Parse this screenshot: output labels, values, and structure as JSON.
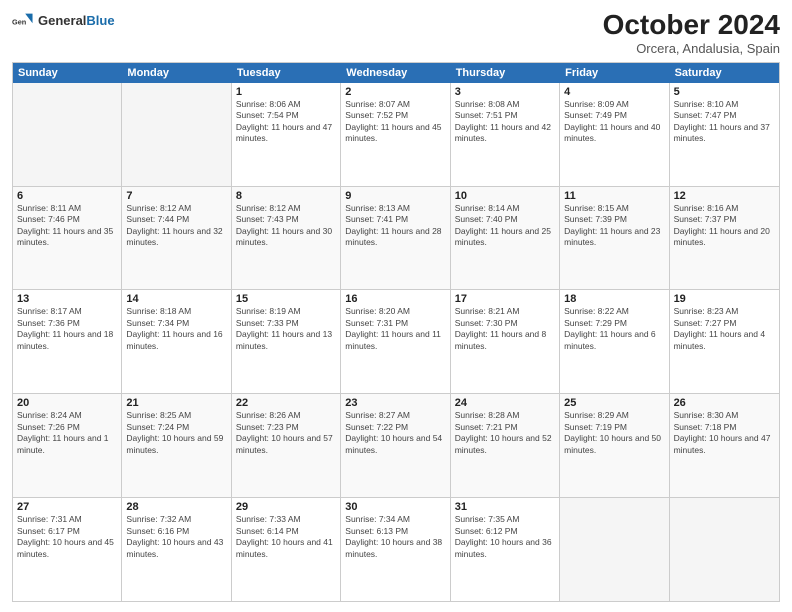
{
  "header": {
    "logo": {
      "text_general": "General",
      "text_blue": "Blue"
    },
    "title": "October 2024",
    "location": "Orcera, Andalusia, Spain"
  },
  "calendar": {
    "weekdays": [
      "Sunday",
      "Monday",
      "Tuesday",
      "Wednesday",
      "Thursday",
      "Friday",
      "Saturday"
    ],
    "rows": [
      [
        {
          "day": "",
          "empty": true
        },
        {
          "day": "",
          "empty": true
        },
        {
          "day": "1",
          "sunrise": "Sunrise: 8:06 AM",
          "sunset": "Sunset: 7:54 PM",
          "daylight": "Daylight: 11 hours and 47 minutes."
        },
        {
          "day": "2",
          "sunrise": "Sunrise: 8:07 AM",
          "sunset": "Sunset: 7:52 PM",
          "daylight": "Daylight: 11 hours and 45 minutes."
        },
        {
          "day": "3",
          "sunrise": "Sunrise: 8:08 AM",
          "sunset": "Sunset: 7:51 PM",
          "daylight": "Daylight: 11 hours and 42 minutes."
        },
        {
          "day": "4",
          "sunrise": "Sunrise: 8:09 AM",
          "sunset": "Sunset: 7:49 PM",
          "daylight": "Daylight: 11 hours and 40 minutes."
        },
        {
          "day": "5",
          "sunrise": "Sunrise: 8:10 AM",
          "sunset": "Sunset: 7:47 PM",
          "daylight": "Daylight: 11 hours and 37 minutes."
        }
      ],
      [
        {
          "day": "6",
          "sunrise": "Sunrise: 8:11 AM",
          "sunset": "Sunset: 7:46 PM",
          "daylight": "Daylight: 11 hours and 35 minutes."
        },
        {
          "day": "7",
          "sunrise": "Sunrise: 8:12 AM",
          "sunset": "Sunset: 7:44 PM",
          "daylight": "Daylight: 11 hours and 32 minutes."
        },
        {
          "day": "8",
          "sunrise": "Sunrise: 8:12 AM",
          "sunset": "Sunset: 7:43 PM",
          "daylight": "Daylight: 11 hours and 30 minutes."
        },
        {
          "day": "9",
          "sunrise": "Sunrise: 8:13 AM",
          "sunset": "Sunset: 7:41 PM",
          "daylight": "Daylight: 11 hours and 28 minutes."
        },
        {
          "day": "10",
          "sunrise": "Sunrise: 8:14 AM",
          "sunset": "Sunset: 7:40 PM",
          "daylight": "Daylight: 11 hours and 25 minutes."
        },
        {
          "day": "11",
          "sunrise": "Sunrise: 8:15 AM",
          "sunset": "Sunset: 7:39 PM",
          "daylight": "Daylight: 11 hours and 23 minutes."
        },
        {
          "day": "12",
          "sunrise": "Sunrise: 8:16 AM",
          "sunset": "Sunset: 7:37 PM",
          "daylight": "Daylight: 11 hours and 20 minutes."
        }
      ],
      [
        {
          "day": "13",
          "sunrise": "Sunrise: 8:17 AM",
          "sunset": "Sunset: 7:36 PM",
          "daylight": "Daylight: 11 hours and 18 minutes."
        },
        {
          "day": "14",
          "sunrise": "Sunrise: 8:18 AM",
          "sunset": "Sunset: 7:34 PM",
          "daylight": "Daylight: 11 hours and 16 minutes."
        },
        {
          "day": "15",
          "sunrise": "Sunrise: 8:19 AM",
          "sunset": "Sunset: 7:33 PM",
          "daylight": "Daylight: 11 hours and 13 minutes."
        },
        {
          "day": "16",
          "sunrise": "Sunrise: 8:20 AM",
          "sunset": "Sunset: 7:31 PM",
          "daylight": "Daylight: 11 hours and 11 minutes."
        },
        {
          "day": "17",
          "sunrise": "Sunrise: 8:21 AM",
          "sunset": "Sunset: 7:30 PM",
          "daylight": "Daylight: 11 hours and 8 minutes."
        },
        {
          "day": "18",
          "sunrise": "Sunrise: 8:22 AM",
          "sunset": "Sunset: 7:29 PM",
          "daylight": "Daylight: 11 hours and 6 minutes."
        },
        {
          "day": "19",
          "sunrise": "Sunrise: 8:23 AM",
          "sunset": "Sunset: 7:27 PM",
          "daylight": "Daylight: 11 hours and 4 minutes."
        }
      ],
      [
        {
          "day": "20",
          "sunrise": "Sunrise: 8:24 AM",
          "sunset": "Sunset: 7:26 PM",
          "daylight": "Daylight: 11 hours and 1 minute."
        },
        {
          "day": "21",
          "sunrise": "Sunrise: 8:25 AM",
          "sunset": "Sunset: 7:24 PM",
          "daylight": "Daylight: 10 hours and 59 minutes."
        },
        {
          "day": "22",
          "sunrise": "Sunrise: 8:26 AM",
          "sunset": "Sunset: 7:23 PM",
          "daylight": "Daylight: 10 hours and 57 minutes."
        },
        {
          "day": "23",
          "sunrise": "Sunrise: 8:27 AM",
          "sunset": "Sunset: 7:22 PM",
          "daylight": "Daylight: 10 hours and 54 minutes."
        },
        {
          "day": "24",
          "sunrise": "Sunrise: 8:28 AM",
          "sunset": "Sunset: 7:21 PM",
          "daylight": "Daylight: 10 hours and 52 minutes."
        },
        {
          "day": "25",
          "sunrise": "Sunrise: 8:29 AM",
          "sunset": "Sunset: 7:19 PM",
          "daylight": "Daylight: 10 hours and 50 minutes."
        },
        {
          "day": "26",
          "sunrise": "Sunrise: 8:30 AM",
          "sunset": "Sunset: 7:18 PM",
          "daylight": "Daylight: 10 hours and 47 minutes."
        }
      ],
      [
        {
          "day": "27",
          "sunrise": "Sunrise: 7:31 AM",
          "sunset": "Sunset: 6:17 PM",
          "daylight": "Daylight: 10 hours and 45 minutes."
        },
        {
          "day": "28",
          "sunrise": "Sunrise: 7:32 AM",
          "sunset": "Sunset: 6:16 PM",
          "daylight": "Daylight: 10 hours and 43 minutes."
        },
        {
          "day": "29",
          "sunrise": "Sunrise: 7:33 AM",
          "sunset": "Sunset: 6:14 PM",
          "daylight": "Daylight: 10 hours and 41 minutes."
        },
        {
          "day": "30",
          "sunrise": "Sunrise: 7:34 AM",
          "sunset": "Sunset: 6:13 PM",
          "daylight": "Daylight: 10 hours and 38 minutes."
        },
        {
          "day": "31",
          "sunrise": "Sunrise: 7:35 AM",
          "sunset": "Sunset: 6:12 PM",
          "daylight": "Daylight: 10 hours and 36 minutes."
        },
        {
          "day": "",
          "empty": true
        },
        {
          "day": "",
          "empty": true
        }
      ]
    ]
  }
}
